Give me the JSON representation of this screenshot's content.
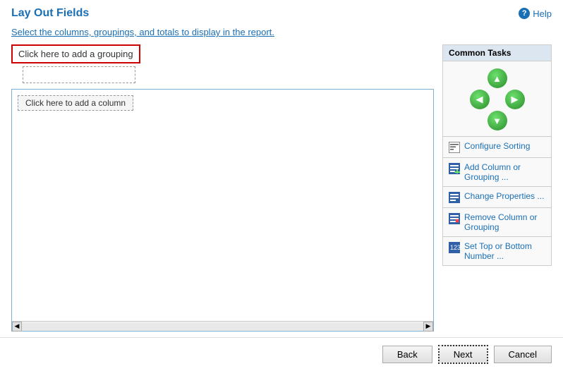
{
  "header": {
    "title": "Lay Out Fields",
    "help_label": "Help"
  },
  "description": {
    "text_before": "Select the columns, groupings, and totals to ",
    "link_text": "display",
    "text_after": " in the report."
  },
  "grouping": {
    "click_label": "Click here to add a grouping"
  },
  "column": {
    "click_label": "Click here to add a column"
  },
  "common_tasks": {
    "title": "Common Tasks",
    "items": [
      {
        "id": "configure-sorting",
        "label": "Configure Sorting",
        "icon_type": "sort"
      },
      {
        "id": "add-column",
        "label": "Add Column or Grouping ...",
        "icon_type": "add"
      },
      {
        "id": "change-properties",
        "label": "Change Properties ...",
        "icon_type": "change"
      },
      {
        "id": "remove-column",
        "label": "Remove Column or Grouping",
        "icon_type": "change"
      },
      {
        "id": "set-top-bottom",
        "label": "Set Top or Bottom Number ...",
        "icon_type": "top"
      }
    ]
  },
  "footer": {
    "back_label": "Back",
    "next_label": "Next",
    "cancel_label": "Cancel"
  }
}
